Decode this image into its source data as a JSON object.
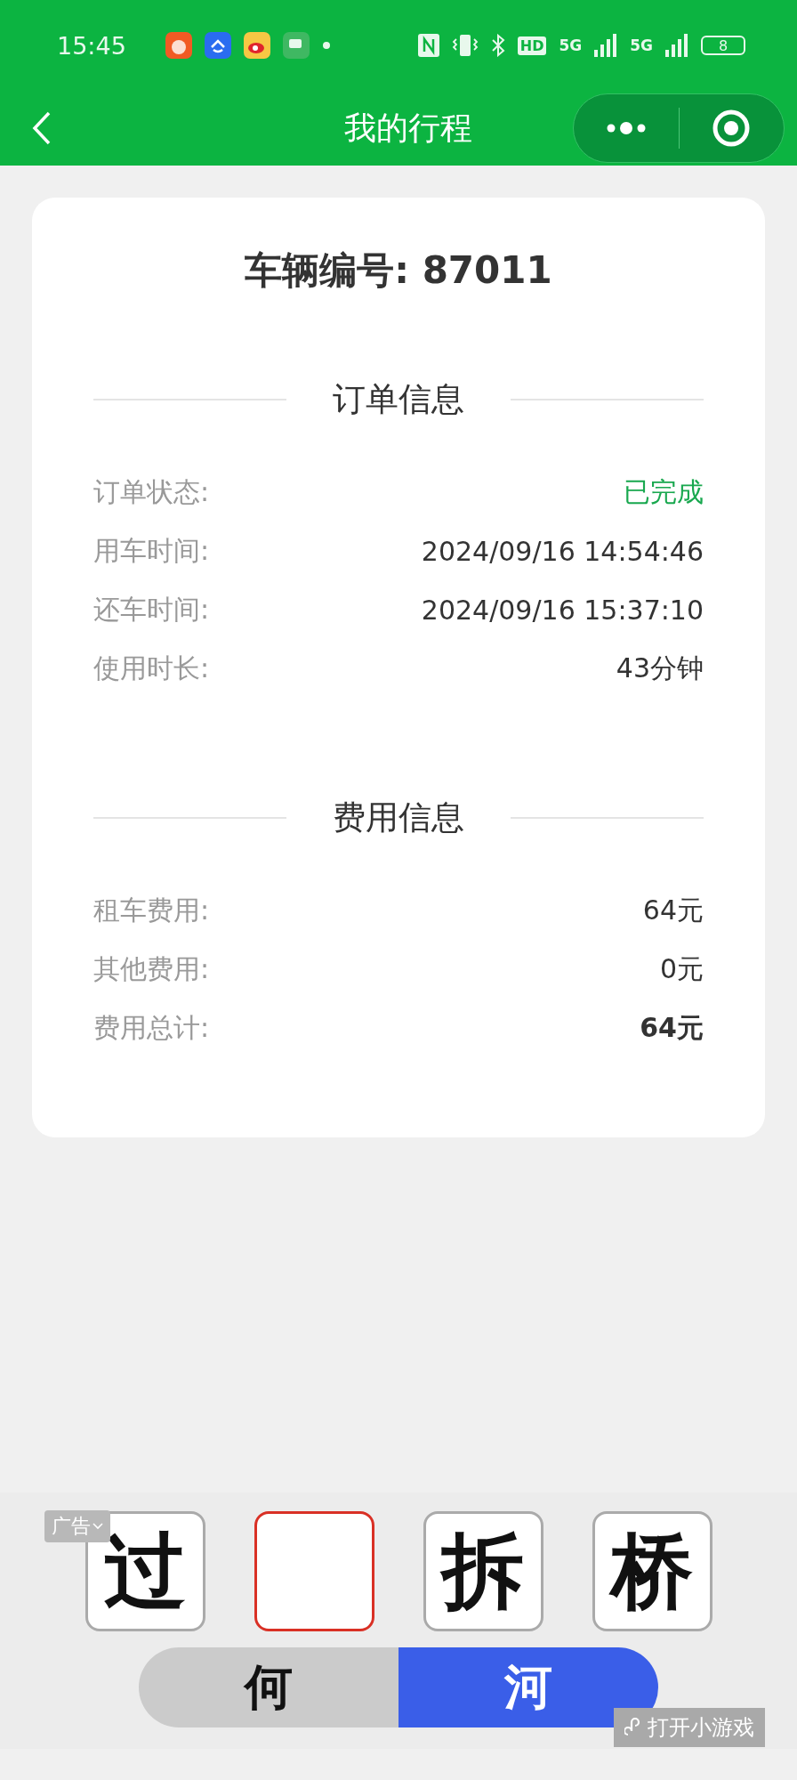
{
  "status_bar": {
    "time": "15:45",
    "network_labels": [
      "HD",
      "5G",
      "5G"
    ],
    "battery": "8"
  },
  "nav": {
    "title": "我的行程"
  },
  "card": {
    "vehicle_title": "车辆编号: 87011",
    "sections": [
      {
        "heading": "订单信息",
        "rows": [
          {
            "label": "订单状态:",
            "value": "已完成",
            "kind": "status"
          },
          {
            "label": "用车时间:",
            "value": "2024/09/16 14:54:46",
            "kind": "plain"
          },
          {
            "label": "还车时间:",
            "value": "2024/09/16 15:37:10",
            "kind": "plain"
          },
          {
            "label": "使用时长:",
            "value": "43分钟",
            "kind": "plain"
          }
        ]
      },
      {
        "heading": "费用信息",
        "rows": [
          {
            "label": "租车费用:",
            "value": "64元",
            "kind": "plain"
          },
          {
            "label": "其他费用:",
            "value": "0元",
            "kind": "plain"
          },
          {
            "label": "费用总计:",
            "value": "64元",
            "kind": "total"
          }
        ]
      }
    ]
  },
  "ad": {
    "label": "广告",
    "tiles": [
      {
        "kind": "letter",
        "char": "过"
      },
      {
        "kind": "blank"
      },
      {
        "kind": "letter",
        "char": "拆"
      },
      {
        "kind": "letter",
        "char": "桥"
      }
    ],
    "choices": [
      {
        "label": "何",
        "selected": false
      },
      {
        "label": "河",
        "selected": true
      }
    ],
    "open_button": "打开小游戏"
  }
}
